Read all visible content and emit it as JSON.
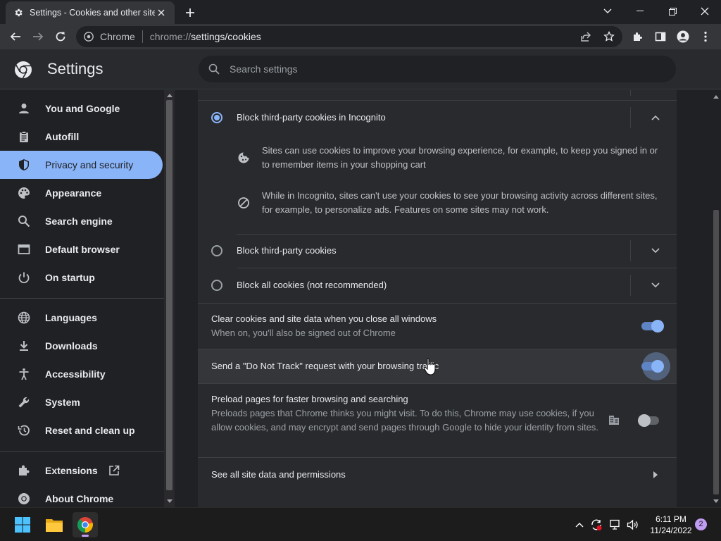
{
  "browser": {
    "tab_title": "Settings - Cookies and other site",
    "omnibox_chip": "Chrome",
    "url_scheme": "chrome://",
    "url_path": "settings/cookies"
  },
  "settings": {
    "title": "Settings",
    "search_placeholder": "Search settings"
  },
  "sidebar": {
    "items": [
      {
        "label": "You and Google",
        "icon": "person-icon"
      },
      {
        "label": "Autofill",
        "icon": "clipboard-icon"
      },
      {
        "label": "Privacy and security",
        "icon": "shield-icon",
        "active": true
      },
      {
        "label": "Appearance",
        "icon": "palette-icon"
      },
      {
        "label": "Search engine",
        "icon": "search-icon"
      },
      {
        "label": "Default browser",
        "icon": "browser-window-icon"
      },
      {
        "label": "On startup",
        "icon": "power-icon"
      },
      {
        "label": "Languages",
        "icon": "globe-icon"
      },
      {
        "label": "Downloads",
        "icon": "download-icon"
      },
      {
        "label": "Accessibility",
        "icon": "accessibility-icon"
      },
      {
        "label": "System",
        "icon": "wrench-icon"
      },
      {
        "label": "Reset and clean up",
        "icon": "history-icon"
      },
      {
        "label": "Extensions",
        "icon": "puzzle-icon"
      },
      {
        "label": "About Chrome",
        "icon": "chrome-icon"
      }
    ]
  },
  "cookies": {
    "options": [
      {
        "label": "Block third-party cookies in Incognito",
        "selected": true,
        "expanded": true
      },
      {
        "label": "Block third-party cookies",
        "selected": false,
        "expanded": false
      },
      {
        "label": "Block all cookies (not recommended)",
        "selected": false,
        "expanded": false
      }
    ],
    "details": [
      "Sites can use cookies to improve your browsing experience, for example, to keep you signed in or to remember items in your shopping cart",
      "While in Incognito, sites can't use your cookies to see your browsing activity across different sites, for example, to personalize ads. Features on some sites may not work."
    ]
  },
  "toggles": {
    "clear_on_close": {
      "title": "Clear cookies and site data when you close all windows",
      "subtitle": "When on, you'll also be signed out of Chrome",
      "on": true
    },
    "do_not_track": {
      "title": "Send a \"Do Not Track\" request with your browsing traffic",
      "on": true
    },
    "preload": {
      "title": "Preload pages for faster browsing and searching",
      "subtitle": "Preloads pages that Chrome thinks you might visit. To do this, Chrome may use cookies, if you allow cookies, and may encrypt and send pages through Google to hide your identity from sites.",
      "on": false
    }
  },
  "see_all": {
    "label": "See all site data and permissions"
  },
  "taskbar": {
    "time": "6:11 PM",
    "date": "11/24/2022",
    "notification_count": "2"
  },
  "colors": {
    "accent": "#8ab4f8",
    "background": "#202124",
    "card": "#292a2d"
  }
}
